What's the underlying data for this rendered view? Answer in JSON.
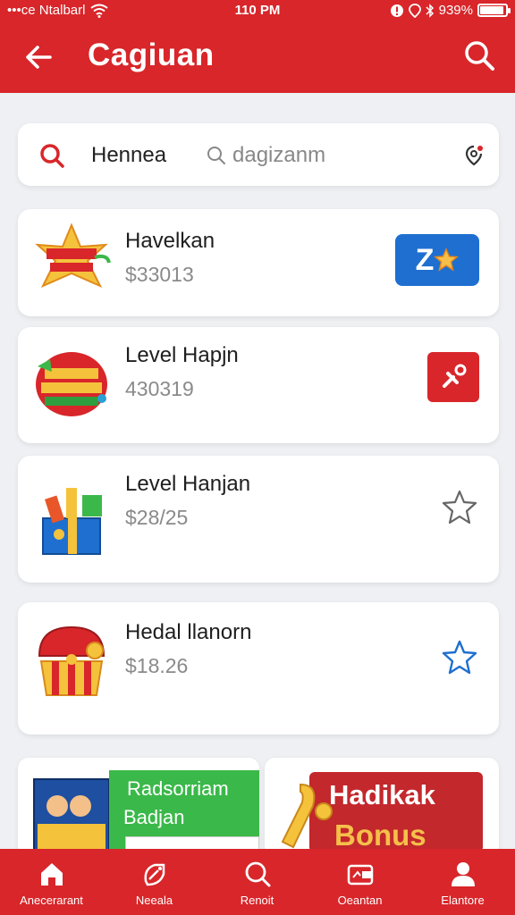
{
  "status_bar": {
    "carrier": "•••ce Ntalbarl",
    "time": "110 PM",
    "battery_text": "939%",
    "battery_level": 0.93
  },
  "header": {
    "title": "Cagiuan",
    "back_icon": "arrow-left-icon",
    "search_icon": "search-icon"
  },
  "search": {
    "query_label": "Hennea",
    "placeholder": "dagizanm"
  },
  "items": [
    {
      "name": "Havelkan",
      "price": "$33013",
      "badge_text": "Z",
      "action": "blue-badge"
    },
    {
      "name": "Level Hapjn",
      "price": "430319",
      "action": "red-badge"
    },
    {
      "name": "Level Hanjan",
      "price": "$28/25",
      "action": "star-outline-gray"
    },
    {
      "name": "Hedal llanorn",
      "price": "$18.26",
      "action": "star-outline-blue"
    }
  ],
  "promos": [
    {
      "line1": "Radsorriam",
      "line2": "Badjan"
    },
    {
      "line1": "Hadikak",
      "line2": "Bonus"
    }
  ],
  "bottom_nav": [
    {
      "label": "Anecerarant",
      "icon": "home-icon"
    },
    {
      "label": "Neeala",
      "icon": "tag-icon"
    },
    {
      "label": "Renoit",
      "icon": "search-icon"
    },
    {
      "label": "Oeantan",
      "icon": "wallet-icon"
    },
    {
      "label": "Elantore",
      "icon": "user-icon"
    }
  ],
  "colors": {
    "brand_red": "#d8262a",
    "badge_blue": "#1e6fd0",
    "promo_green": "#3bb84a",
    "bonus_gold": "#f5c04a"
  }
}
